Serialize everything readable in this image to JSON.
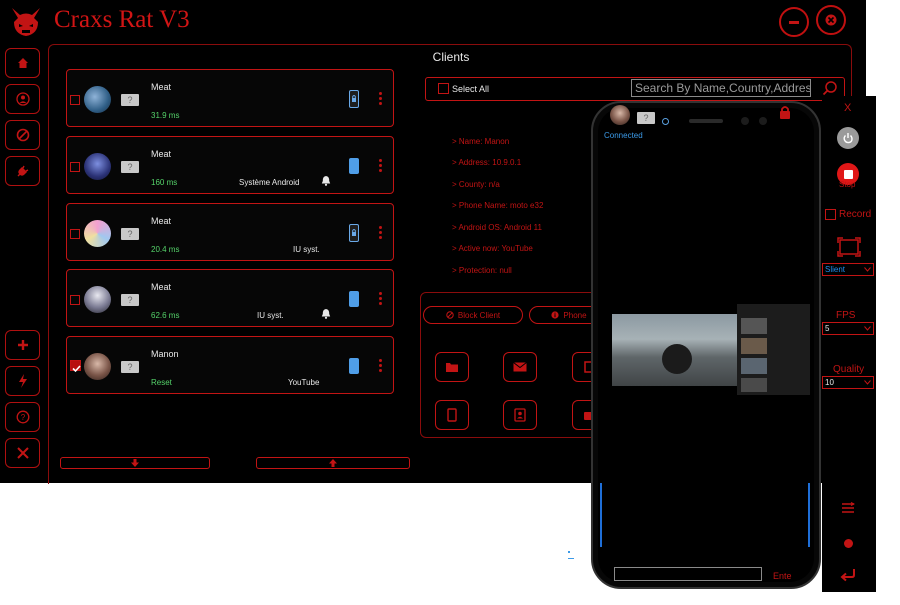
{
  "app": {
    "title": "Craxs Rat V3",
    "section_title": "Clients"
  },
  "sidebar": {
    "top_icons": [
      "home-icon",
      "user-icon",
      "block-icon",
      "plug-icon"
    ],
    "bottom_icons": [
      "plus-icon",
      "lightning-icon",
      "help-icon",
      "tools-icon"
    ]
  },
  "clients": [
    {
      "name": "Meat",
      "ping": "31.9 ms",
      "extra": "",
      "checked": false,
      "device_icon": "locked-phone-icon",
      "bell": false
    },
    {
      "name": "Meat",
      "ping": "160 ms",
      "extra": "Système Android",
      "checked": false,
      "device_icon": "phone-icon",
      "bell": true
    },
    {
      "name": "Meat",
      "ping": "20.4 ms",
      "extra": "IU syst.",
      "checked": false,
      "device_icon": "locked-phone-icon",
      "bell": false
    },
    {
      "name": "Meat",
      "ping": "62.6 ms",
      "extra": "IU syst.",
      "checked": false,
      "device_icon": "phone-icon",
      "bell": true
    },
    {
      "name": "Manon",
      "ping": "Reset",
      "extra": "YouTube",
      "checked": true,
      "device_icon": "phone-icon",
      "bell": false
    }
  ],
  "qmark": "?",
  "search": {
    "select_all_label": "Select All",
    "placeholder": "Search By Name,Country,Addres..."
  },
  "client_info": [
    "> Name: Manon",
    "> Address: 10.9.0.1",
    "> County: n/a",
    "> Phone Name: moto e32",
    "> Android OS: Android 11",
    "> Active now: YouTube",
    "> Protection: null"
  ],
  "actions": {
    "block_client": "Block Client",
    "phone_label": "Phone"
  },
  "screen_viewer": {
    "status": "Connected",
    "close_label": "X",
    "stop_label": "Stop",
    "record_label": "Record",
    "mode_value": "Slient",
    "fps_label": "FPS",
    "fps_value": "5",
    "quality_label": "Quality",
    "quality_value": "10",
    "enter_label": "Ente"
  },
  "colors": {
    "accent": "#c21414",
    "ping_green": "#55d36a",
    "link_blue": "#1f8ff0"
  }
}
